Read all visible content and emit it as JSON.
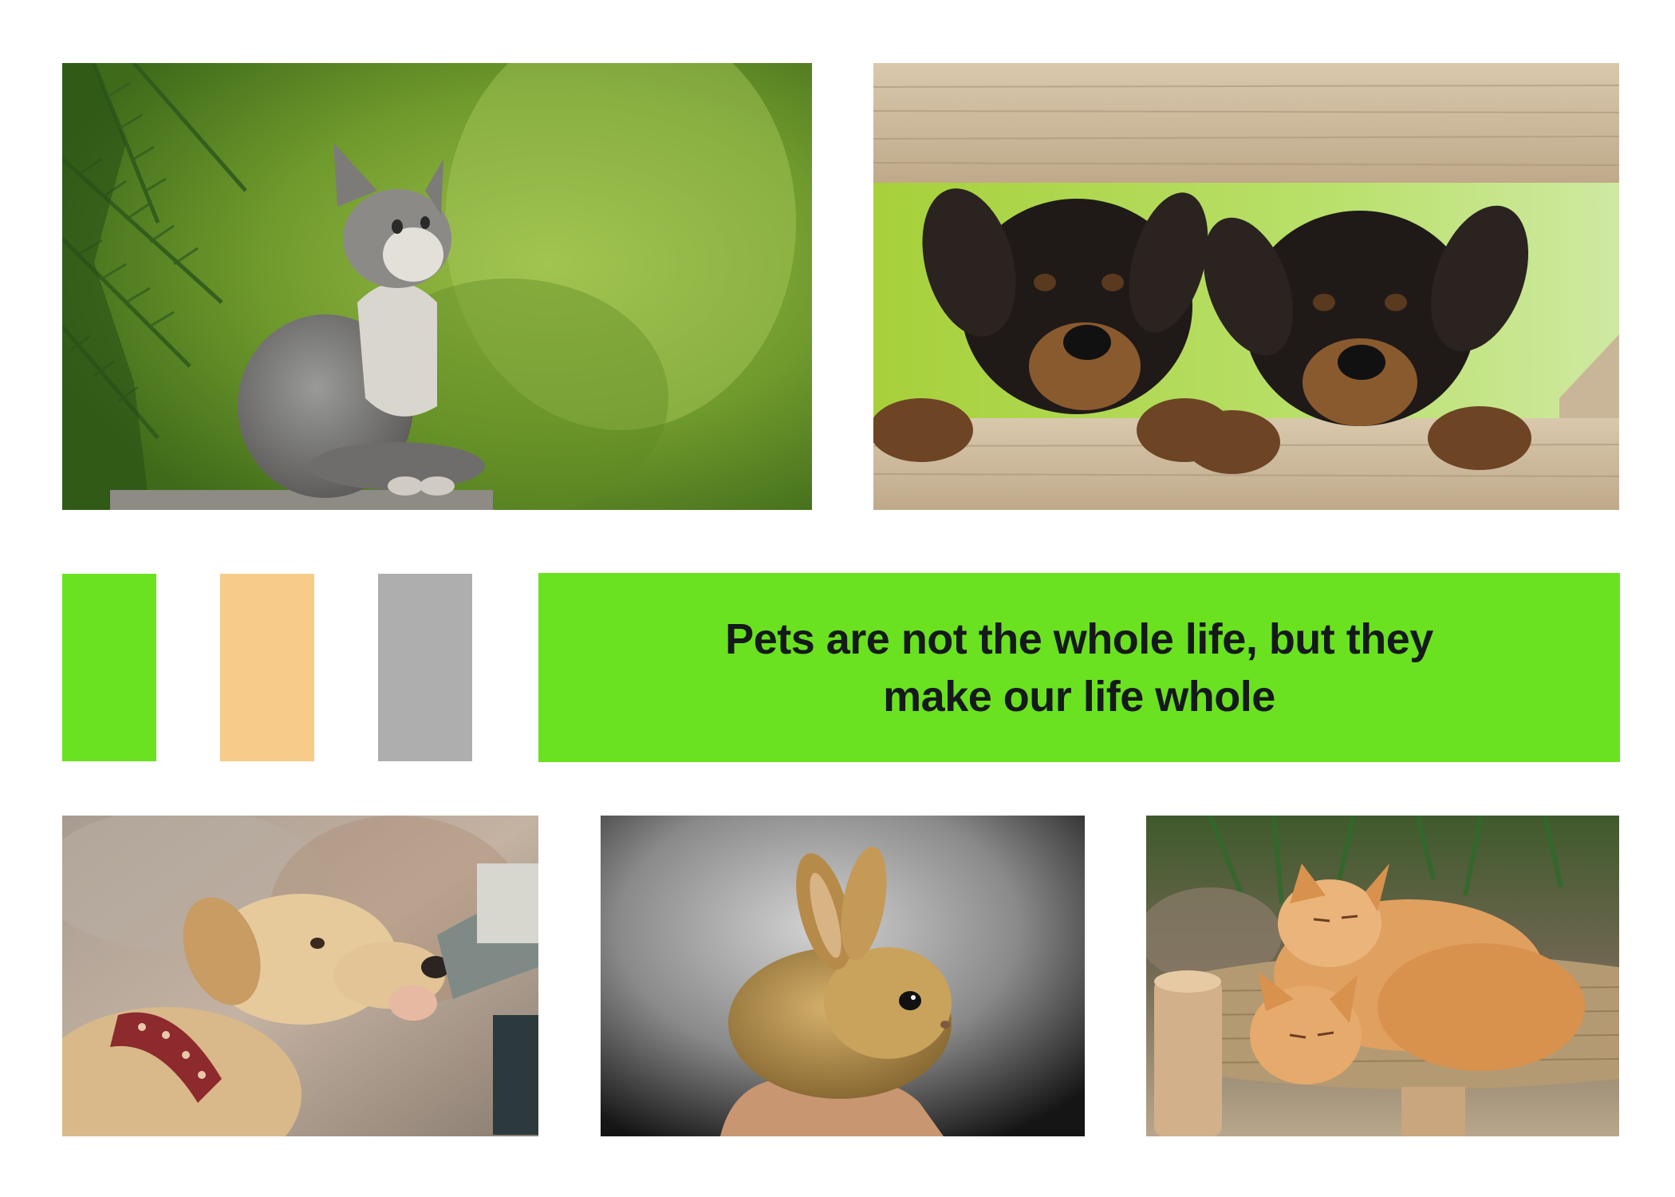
{
  "palette": {
    "colors": [
      "#6ae220",
      "#f6cc88",
      "#aeaeae"
    ],
    "names": [
      "green-swatch",
      "peach-swatch",
      "gray-swatch"
    ]
  },
  "quote": {
    "text": "Pets are not the whole life, but they make our life whole",
    "background": "#6ae220",
    "text_color": "#15191a"
  },
  "photos": [
    {
      "name": "photo-gray-kitten",
      "subject": "gray kitten looking up among pine branches"
    },
    {
      "name": "photo-rottweiler-puppies",
      "subject": "two rottweiler puppies peeking over wooden fence"
    },
    {
      "name": "photo-golden-dog",
      "subject": "golden dog with red collar sniffing a hand"
    },
    {
      "name": "photo-bunny",
      "subject": "small brown bunny held in a hand"
    },
    {
      "name": "photo-orange-kittens",
      "subject": "two orange kittens sleeping on a wicker bed"
    }
  ]
}
